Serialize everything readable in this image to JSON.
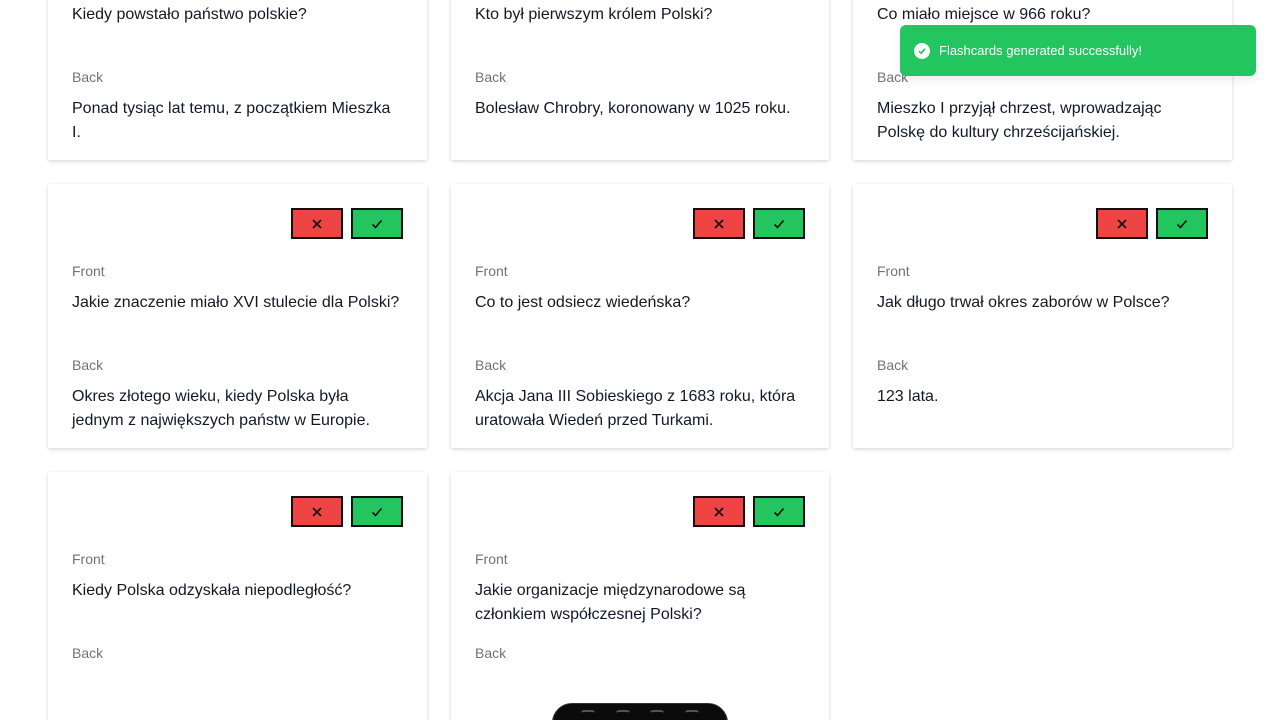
{
  "toast": {
    "message": "Flashcards generated successfully!",
    "color": "#22c55e"
  },
  "labels": {
    "front": "Front",
    "back": "Back"
  },
  "colors": {
    "reject": "#ef4444",
    "accept": "#22c55e"
  },
  "cards": [
    {
      "front": "Kiedy powstało państwo polskie?",
      "back": "Ponad tysiąc lat temu, z początkiem Mieszka I."
    },
    {
      "front": "Kto był pierwszym królem Polski?",
      "back": "Bolesław Chrobry, koronowany w 1025 roku."
    },
    {
      "front": "Co miało miejsce w 966 roku?",
      "back": "Mieszko I przyjął chrzest, wprowadzając Polskę do kultury chrześcijańskiej."
    },
    {
      "front": "Jakie znaczenie miało XVI stulecie dla Polski?",
      "back": "Okres złotego wieku, kiedy Polska była jednym z największych państw w Europie."
    },
    {
      "front": "Co to jest odsiecz wiedeńska?",
      "back": "Akcja Jana III Sobieskiego z 1683 roku, która uratowała Wiedeń przed Turkami."
    },
    {
      "front": "Jak długo trwał okres zaborów w Polsce?",
      "back": "123 lata."
    },
    {
      "front": "Kiedy Polska odzyskała niepodległość?",
      "back": ""
    },
    {
      "front": "Jakie organizacje międzynarodowe są członkiem współczesnej Polski?",
      "back": ""
    }
  ]
}
